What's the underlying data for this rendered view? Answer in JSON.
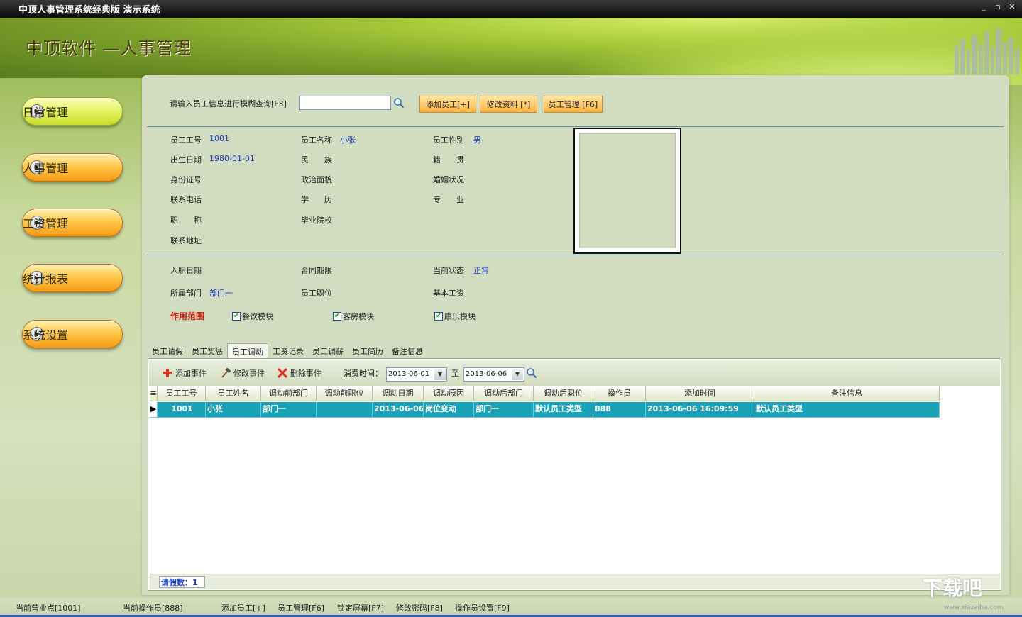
{
  "window": {
    "title": "中顶人事管理系统经典版 演示系统",
    "controls": [
      "_",
      "▫",
      "✕"
    ]
  },
  "brand": "中顶软件 —人事管理",
  "nav": [
    {
      "label": "日常管理",
      "style": "yellow"
    },
    {
      "label": "人事管理",
      "style": "orange"
    },
    {
      "label": "工资管理",
      "style": "orange"
    },
    {
      "label": "统计报表",
      "style": "orange"
    },
    {
      "label": "系统设置",
      "style": "orange"
    }
  ],
  "search": {
    "label": "请输入员工信息进行模糊查询[F3]",
    "value": "",
    "placeholder": ""
  },
  "actions": {
    "add_employee": "添加员工[+]",
    "edit_info": "修改资料 [*]",
    "employee_mgmt": "员工管理 [F6]"
  },
  "profile": {
    "emp_no_label": "员工工号",
    "emp_no": "1001",
    "emp_name_label": "员工名称",
    "emp_name": "小张",
    "gender_label": "员工性别",
    "gender": "男",
    "birth_label": "出生日期",
    "birth": "1980-01-01",
    "ethnic_label": "民　　族",
    "native_label": "籍　　贯",
    "id_label": "身份证号",
    "political_label": "政治面貌",
    "marital_label": "婚姻状况",
    "phone_label": "联系电话",
    "education_label": "学　　历",
    "major_label": "专　　业",
    "title_label": "职　　称",
    "school_label": "毕业院校",
    "address_label": "联系地址"
  },
  "employment": {
    "hire_label": "入职日期",
    "contract_label": "合同期限",
    "status_label": "当前状态",
    "status": "正常",
    "dept_label": "所属部门",
    "dept": "部门一",
    "position_label": "员工职位",
    "salary_label": "基本工资",
    "scope_label": "作用范围",
    "modules": [
      {
        "label": "餐饮模块",
        "checked": true
      },
      {
        "label": "客房模块",
        "checked": true
      },
      {
        "label": "康乐模块",
        "checked": true
      }
    ]
  },
  "tabs": [
    "员工请假",
    "员工奖惩",
    "员工调动",
    "工资记录",
    "员工调薪",
    "员工简历",
    "备注信息"
  ],
  "active_tab": "员工调动",
  "toolbar": {
    "add_event": "添加事件",
    "edit_event": "修改事件",
    "delete_event": "删除事件",
    "period_label": "消费时间：",
    "date_from": "2013-06-01",
    "to_label": "至",
    "date_to": "2013-06-06"
  },
  "grid": {
    "columns": [
      "员工工号",
      "员工姓名",
      "调动前部门",
      "调动前职位",
      "调动日期",
      "调动原因",
      "调动后部门",
      "调动后职位",
      "操作员",
      "添加时间",
      "备注信息"
    ],
    "rows": [
      [
        "1001",
        "小张",
        "部门一",
        "",
        "2013-06-06",
        "岗位变动",
        "部门一",
        "默认员工类型",
        "888",
        "2013-06-06 16:09:59",
        "默认员工类型"
      ]
    ],
    "footer": "请假数：1"
  },
  "status_bar": {
    "branch": "当前营业点[1001]",
    "operator": "当前操作员[888]",
    "add_employee": "添加员工[+]",
    "employee_mgmt": "员工管理[F6]",
    "lock_screen": "锁定屏幕[F7]",
    "change_password": "修改密码[F8]",
    "operator_settings": "操作员设置[F9]"
  },
  "watermark": {
    "text": "下载吧",
    "url": "www.xiazaiba.com"
  },
  "colors": {
    "accent_value": "#1a3fc4",
    "scope_red": "#d42010",
    "selected_row": "#1aa3b8"
  }
}
